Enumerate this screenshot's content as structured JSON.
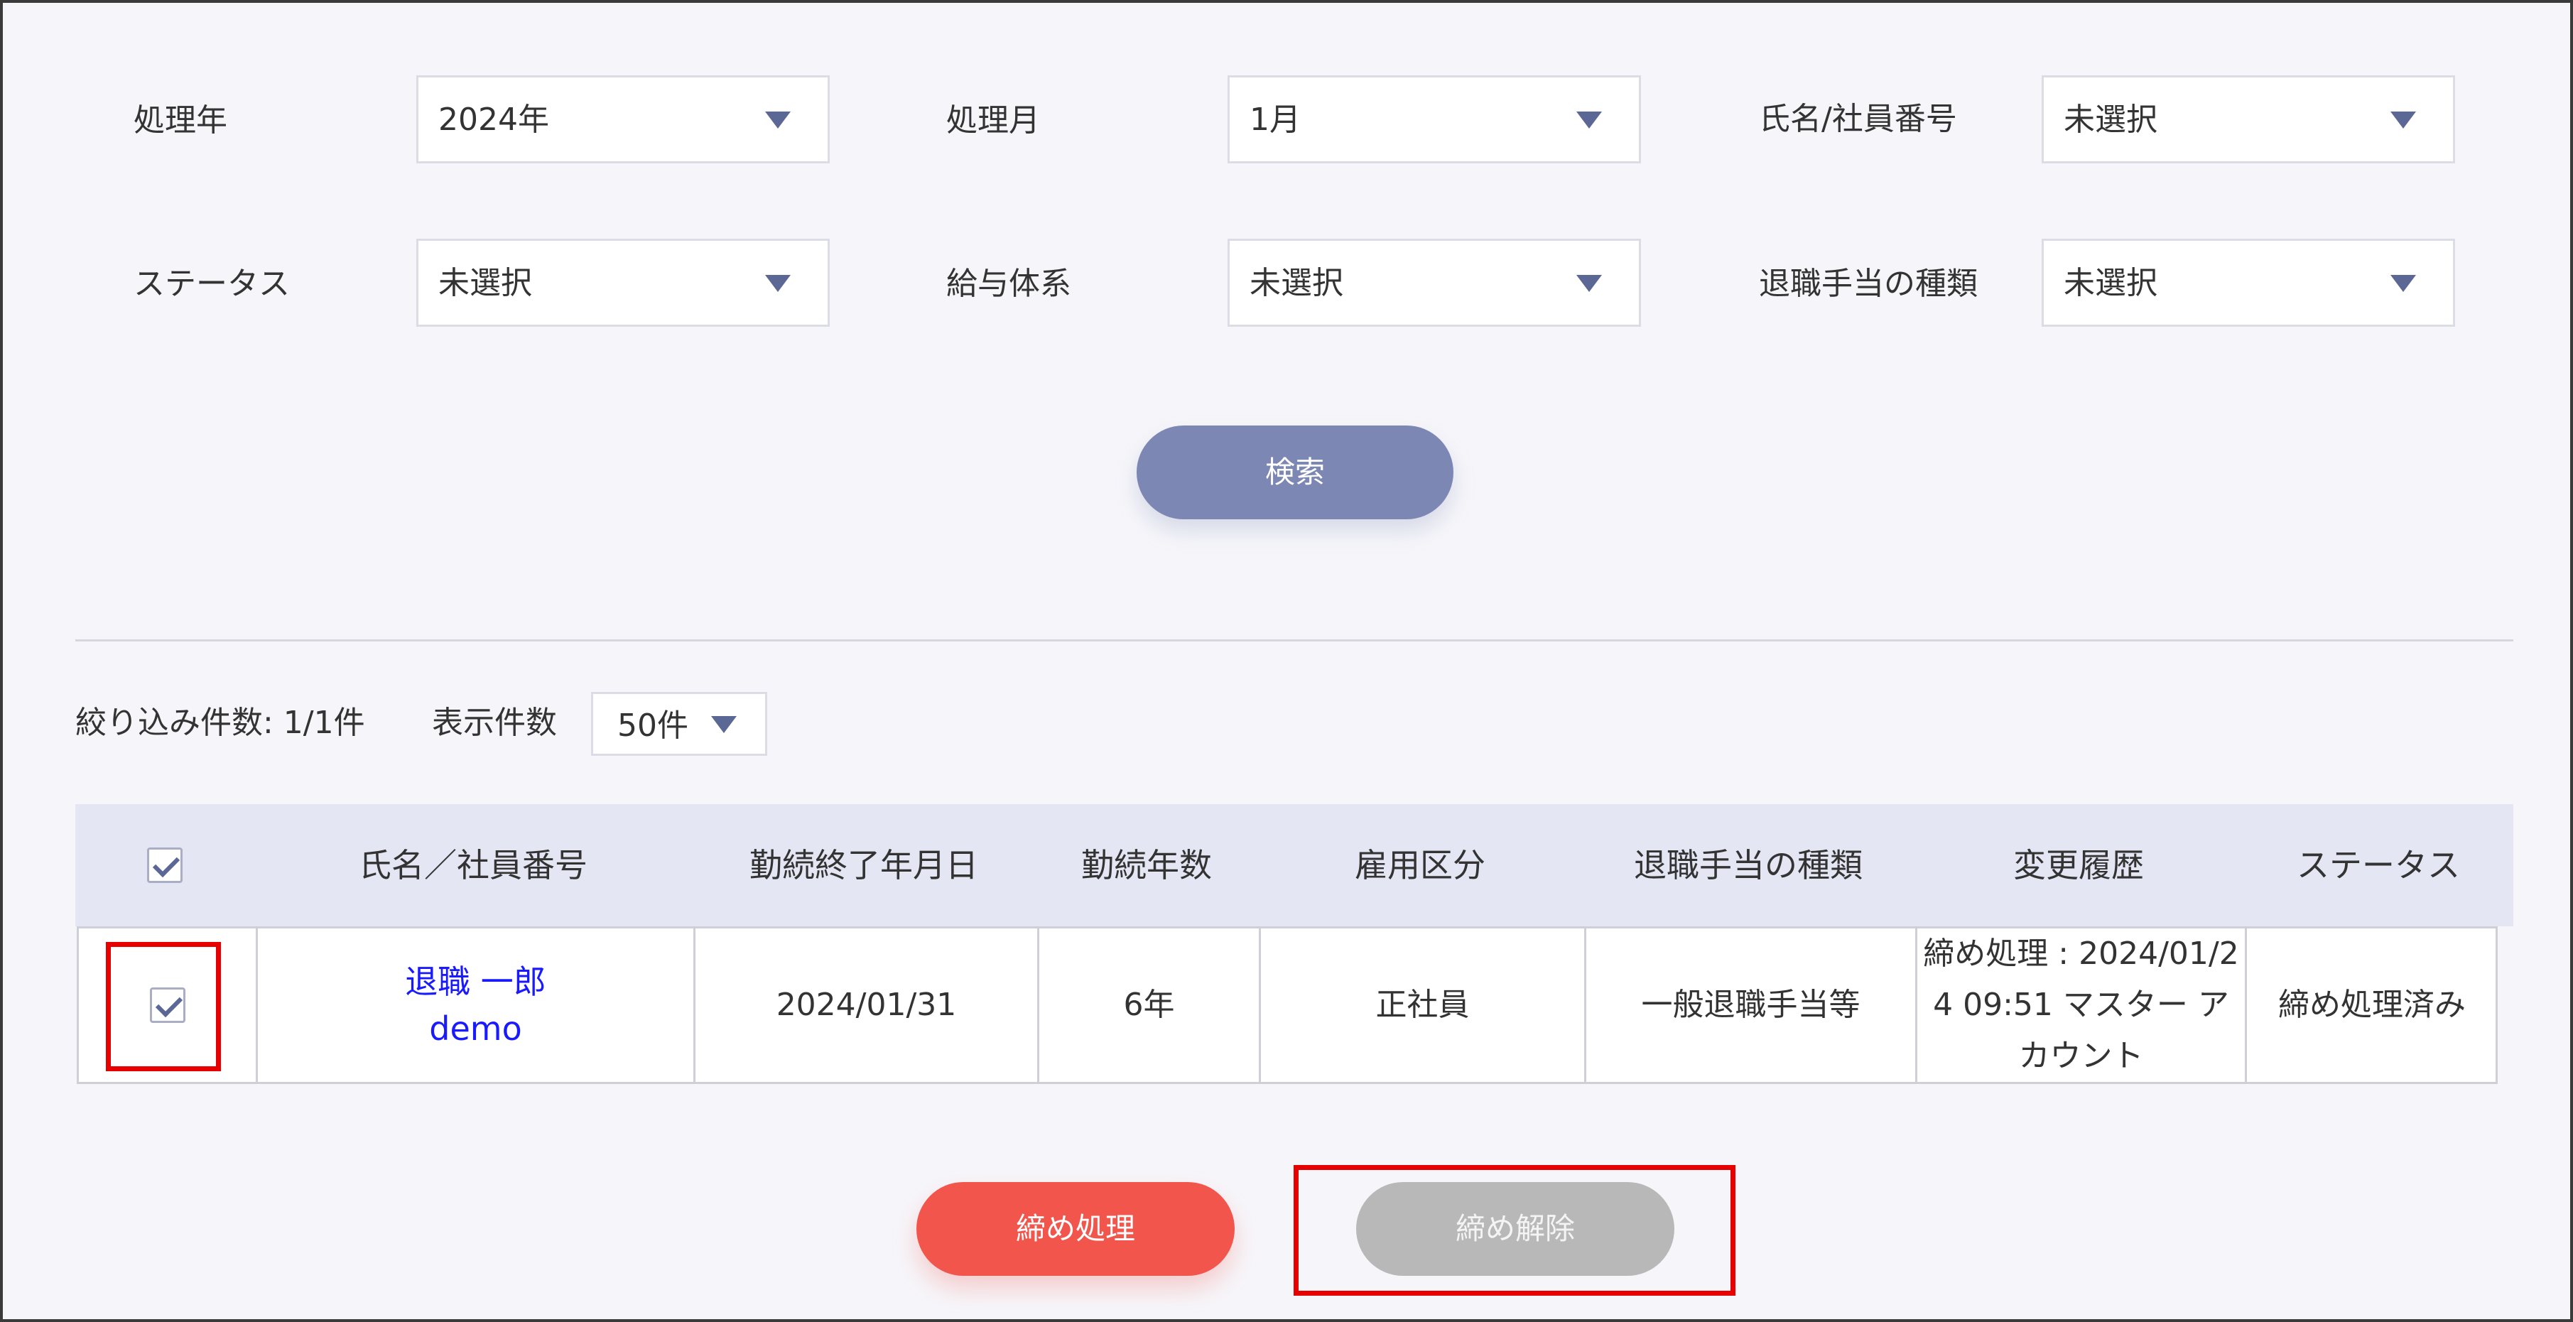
{
  "filters": {
    "year": {
      "label": "処理年",
      "value": "2024年"
    },
    "month": {
      "label": "処理月",
      "value": "1月"
    },
    "employee": {
      "label": "氏名/社員番号",
      "value": "未選択"
    },
    "status": {
      "label": "ステータス",
      "value": "未選択"
    },
    "salary_system": {
      "label": "給与体系",
      "value": "未選択"
    },
    "allowance_type": {
      "label": "退職手当の種類",
      "value": "未選択"
    }
  },
  "search_button": "検索",
  "results": {
    "count_text": "絞り込み件数: 1/1件",
    "per_page_label": "表示件数",
    "per_page_value": "50件"
  },
  "table": {
    "headers": [
      "氏名／社員番号",
      "勤続終了年月日",
      "勤続年数",
      "雇用区分",
      "退職手当の種類",
      "変更履歴",
      "ステータス"
    ],
    "rows": [
      {
        "name": "退職 一郎",
        "employee_no": "demo",
        "end_date": "2024/01/31",
        "years": "6年",
        "employment_type": "正社員",
        "allowance_type": "一般退職手当等",
        "history_line1": "締め処理 : 2024/01/2",
        "history_line2": "4 09:51 マスター ア",
        "history_line3": "カウント",
        "status": "締め処理済み"
      }
    ]
  },
  "actions": {
    "close_button": "締め処理",
    "release_button": "締め解除"
  },
  "colors": {
    "accent": "#7c87b3",
    "close": "#f2554b",
    "disabled": "#b8b8b8",
    "highlight": "#e60000"
  }
}
